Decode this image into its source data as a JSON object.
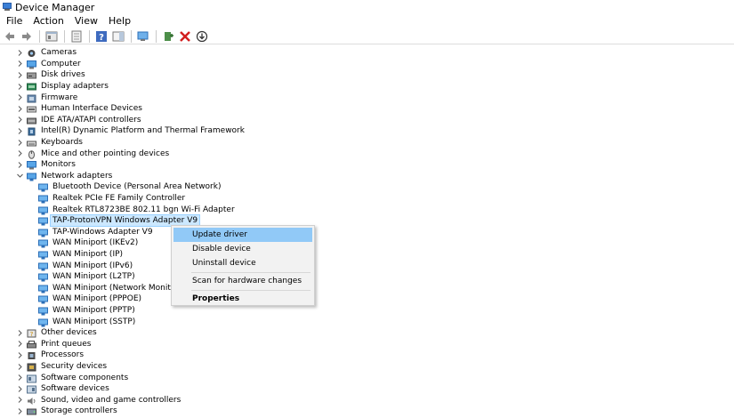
{
  "window": {
    "title": "Device Manager"
  },
  "menu": [
    "File",
    "Action",
    "View",
    "Help"
  ],
  "toolbar": [
    {
      "name": "back-icon"
    },
    {
      "name": "forward-icon"
    },
    {
      "name": "sep"
    },
    {
      "name": "properties-icon"
    },
    {
      "name": "sep"
    },
    {
      "name": "show-hidden-icon"
    },
    {
      "name": "sep"
    },
    {
      "name": "help-icon"
    },
    {
      "name": "action-pane-icon"
    },
    {
      "name": "sep"
    },
    {
      "name": "scan-hardware-icon"
    },
    {
      "name": "sep"
    },
    {
      "name": "add-driver-icon"
    },
    {
      "name": "uninstall-icon"
    },
    {
      "name": "download-icon"
    }
  ],
  "tree": [
    {
      "label": "Cameras",
      "icon": "camera-icon",
      "level": 0,
      "expanded": false
    },
    {
      "label": "Computer",
      "icon": "computer-icon",
      "level": 0,
      "expanded": false
    },
    {
      "label": "Disk drives",
      "icon": "disk-icon",
      "level": 0,
      "expanded": false
    },
    {
      "label": "Display adapters",
      "icon": "display-icon",
      "level": 0,
      "expanded": false
    },
    {
      "label": "Firmware",
      "icon": "firmware-icon",
      "level": 0,
      "expanded": false
    },
    {
      "label": "Human Interface Devices",
      "icon": "hid-icon",
      "level": 0,
      "expanded": false
    },
    {
      "label": "IDE ATA/ATAPI controllers",
      "icon": "ide-icon",
      "level": 0,
      "expanded": false
    },
    {
      "label": "Intel(R) Dynamic Platform and Thermal Framework",
      "icon": "chip-icon",
      "level": 0,
      "expanded": false
    },
    {
      "label": "Keyboards",
      "icon": "keyboard-icon",
      "level": 0,
      "expanded": false
    },
    {
      "label": "Mice and other pointing devices",
      "icon": "mouse-icon",
      "level": 0,
      "expanded": false
    },
    {
      "label": "Monitors",
      "icon": "monitor-icon",
      "level": 0,
      "expanded": false
    },
    {
      "label": "Network adapters",
      "icon": "network-icon",
      "level": 0,
      "expanded": true
    },
    {
      "label": "Bluetooth Device (Personal Area Network)",
      "icon": "network-adapter-icon",
      "level": 1
    },
    {
      "label": "Realtek PCIe FE Family Controller",
      "icon": "network-adapter-icon",
      "level": 1
    },
    {
      "label": "Realtek RTL8723BE 802.11 bgn Wi-Fi Adapter",
      "icon": "network-adapter-icon",
      "level": 1
    },
    {
      "label": "TAP-ProtonVPN Windows Adapter V9",
      "icon": "network-adapter-icon",
      "level": 1,
      "selected": true
    },
    {
      "label": "TAP-Windows Adapter V9",
      "icon": "network-adapter-icon",
      "level": 1
    },
    {
      "label": "WAN Miniport (IKEv2)",
      "icon": "network-adapter-icon",
      "level": 1
    },
    {
      "label": "WAN Miniport (IP)",
      "icon": "network-adapter-icon",
      "level": 1
    },
    {
      "label": "WAN Miniport (IPv6)",
      "icon": "network-adapter-icon",
      "level": 1
    },
    {
      "label": "WAN Miniport (L2TP)",
      "icon": "network-adapter-icon",
      "level": 1
    },
    {
      "label": "WAN Miniport (Network Monitor)",
      "icon": "network-adapter-icon",
      "level": 1
    },
    {
      "label": "WAN Miniport (PPPOE)",
      "icon": "network-adapter-icon",
      "level": 1
    },
    {
      "label": "WAN Miniport (PPTP)",
      "icon": "network-adapter-icon",
      "level": 1
    },
    {
      "label": "WAN Miniport (SSTP)",
      "icon": "network-adapter-icon",
      "level": 1
    },
    {
      "label": "Other devices",
      "icon": "other-devices-icon",
      "level": 0,
      "expanded": false
    },
    {
      "label": "Print queues",
      "icon": "printer-icon",
      "level": 0,
      "expanded": false
    },
    {
      "label": "Processors",
      "icon": "processor-icon",
      "level": 0,
      "expanded": false
    },
    {
      "label": "Security devices",
      "icon": "security-icon",
      "level": 0,
      "expanded": false
    },
    {
      "label": "Software components",
      "icon": "software-component-icon",
      "level": 0,
      "expanded": false
    },
    {
      "label": "Software devices",
      "icon": "software-device-icon",
      "level": 0,
      "expanded": false
    },
    {
      "label": "Sound, video and game controllers",
      "icon": "sound-icon",
      "level": 0,
      "expanded": false
    },
    {
      "label": "Storage controllers",
      "icon": "storage-icon",
      "level": 0,
      "expanded": false
    }
  ],
  "context_menu": {
    "items": [
      {
        "label": "Update driver",
        "highlighted": true
      },
      {
        "label": "Disable device"
      },
      {
        "label": "Uninstall device"
      },
      {
        "separator": true
      },
      {
        "label": "Scan for hardware changes"
      },
      {
        "separator": true
      },
      {
        "label": "Properties",
        "bold": true
      }
    ]
  },
  "colors": {
    "selection": "#cce8ff",
    "menu_highlight": "#91c9f7",
    "menu_bg": "#f2f2f2"
  }
}
